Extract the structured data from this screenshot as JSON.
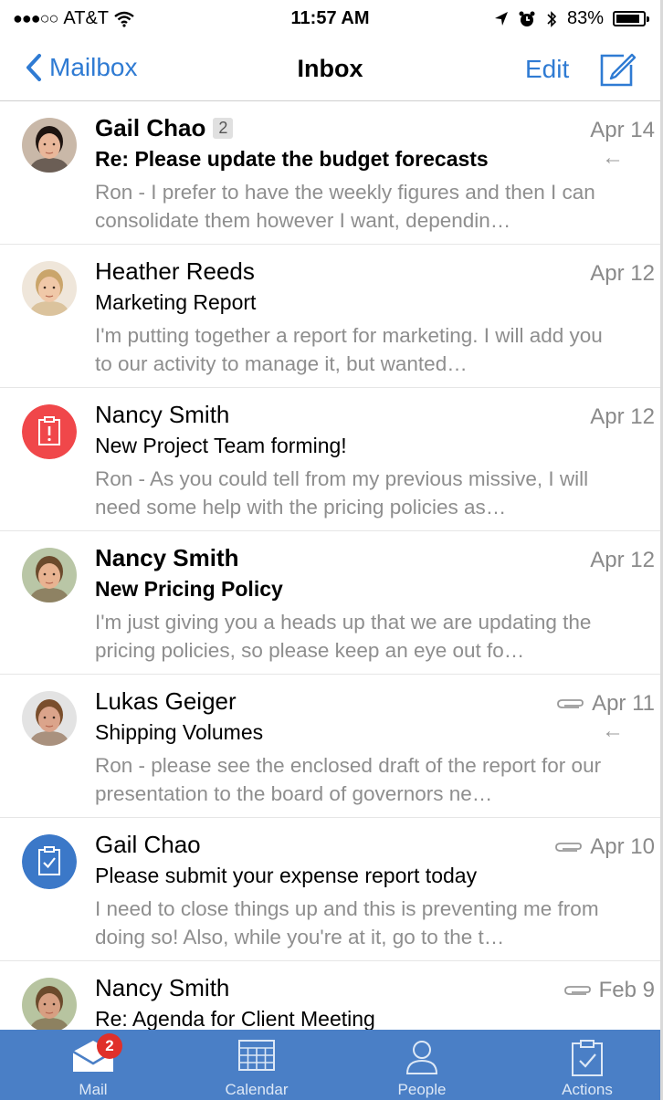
{
  "status_bar": {
    "signal": "●●●○○",
    "carrier": "AT&T",
    "time": "11:57 AM",
    "battery_percent": "83%",
    "battery_level": 0.83,
    "icons": [
      "wifi-icon",
      "location-icon",
      "alarm-icon",
      "bluetooth-icon",
      "battery-icon"
    ]
  },
  "nav": {
    "back_label": "Mailbox",
    "title": "Inbox",
    "edit_label": "Edit",
    "compose_icon": "compose-icon"
  },
  "messages": [
    {
      "sender": "Gail Chao",
      "thread_count": "2",
      "date": "Apr 14",
      "subject": "Re: Please update the budget forecasts",
      "preview": "Ron - I prefer to have the weekly figures and then I can consolidate them however I want, dependin…",
      "unread": true,
      "replied": true,
      "attachment": false,
      "avatar": "photo"
    },
    {
      "sender": "Heather Reeds",
      "date": "Apr 12",
      "subject": "Marketing Report",
      "preview": "I'm putting together a report for marketing. I will add you to our activity to manage it, but wanted…",
      "unread": false,
      "replied": false,
      "attachment": false,
      "avatar": "photo"
    },
    {
      "sender": "Nancy Smith",
      "date": "Apr 12",
      "subject": "New Project Team forming!",
      "preview": "Ron - As you could tell from my previous missive, I will need some help with the pricing policies as…",
      "unread": false,
      "replied": false,
      "attachment": false,
      "avatar": "alert-clipboard-icon",
      "avatar_color": "#f0474a"
    },
    {
      "sender": "Nancy Smith",
      "date": "Apr 12",
      "subject": "New Pricing Policy",
      "preview": "I'm just giving you a heads up that we are updating the pricing policies, so please keep an eye out fo…",
      "unread": true,
      "replied": false,
      "attachment": false,
      "avatar": "photo"
    },
    {
      "sender": "Lukas Geiger",
      "date": "Apr 11",
      "subject": "Shipping Volumes",
      "preview": "Ron - please see the enclosed draft of the report for our presentation to the board of governors ne…",
      "unread": false,
      "replied": true,
      "attachment": true,
      "avatar": "photo"
    },
    {
      "sender": "Gail Chao",
      "date": "Apr 10",
      "subject": "Please submit your expense report today",
      "preview": "I need to close things up and this is preventing me from doing so! Also, while you're at it, go to the t…",
      "unread": false,
      "replied": false,
      "attachment": true,
      "avatar": "check-clipboard-icon",
      "avatar_color": "#3b78c8"
    },
    {
      "sender": "Nancy Smith",
      "date": "Feb 9",
      "subject": "Re: Agenda for Client Meeting",
      "preview": "",
      "unread": false,
      "replied": false,
      "attachment": true,
      "avatar": "photo"
    }
  ],
  "tabs": [
    {
      "label": "Mail",
      "icon": "mail-icon",
      "badge": "2"
    },
    {
      "label": "Calendar",
      "icon": "calendar-icon"
    },
    {
      "label": "People",
      "icon": "person-icon"
    },
    {
      "label": "Actions",
      "icon": "clipboard-check-icon"
    }
  ],
  "colors": {
    "accent": "#2f7bd3",
    "tab_bar": "#4a7fc6",
    "badge": "#e0302a",
    "secondary_text": "#8e8e8e"
  }
}
